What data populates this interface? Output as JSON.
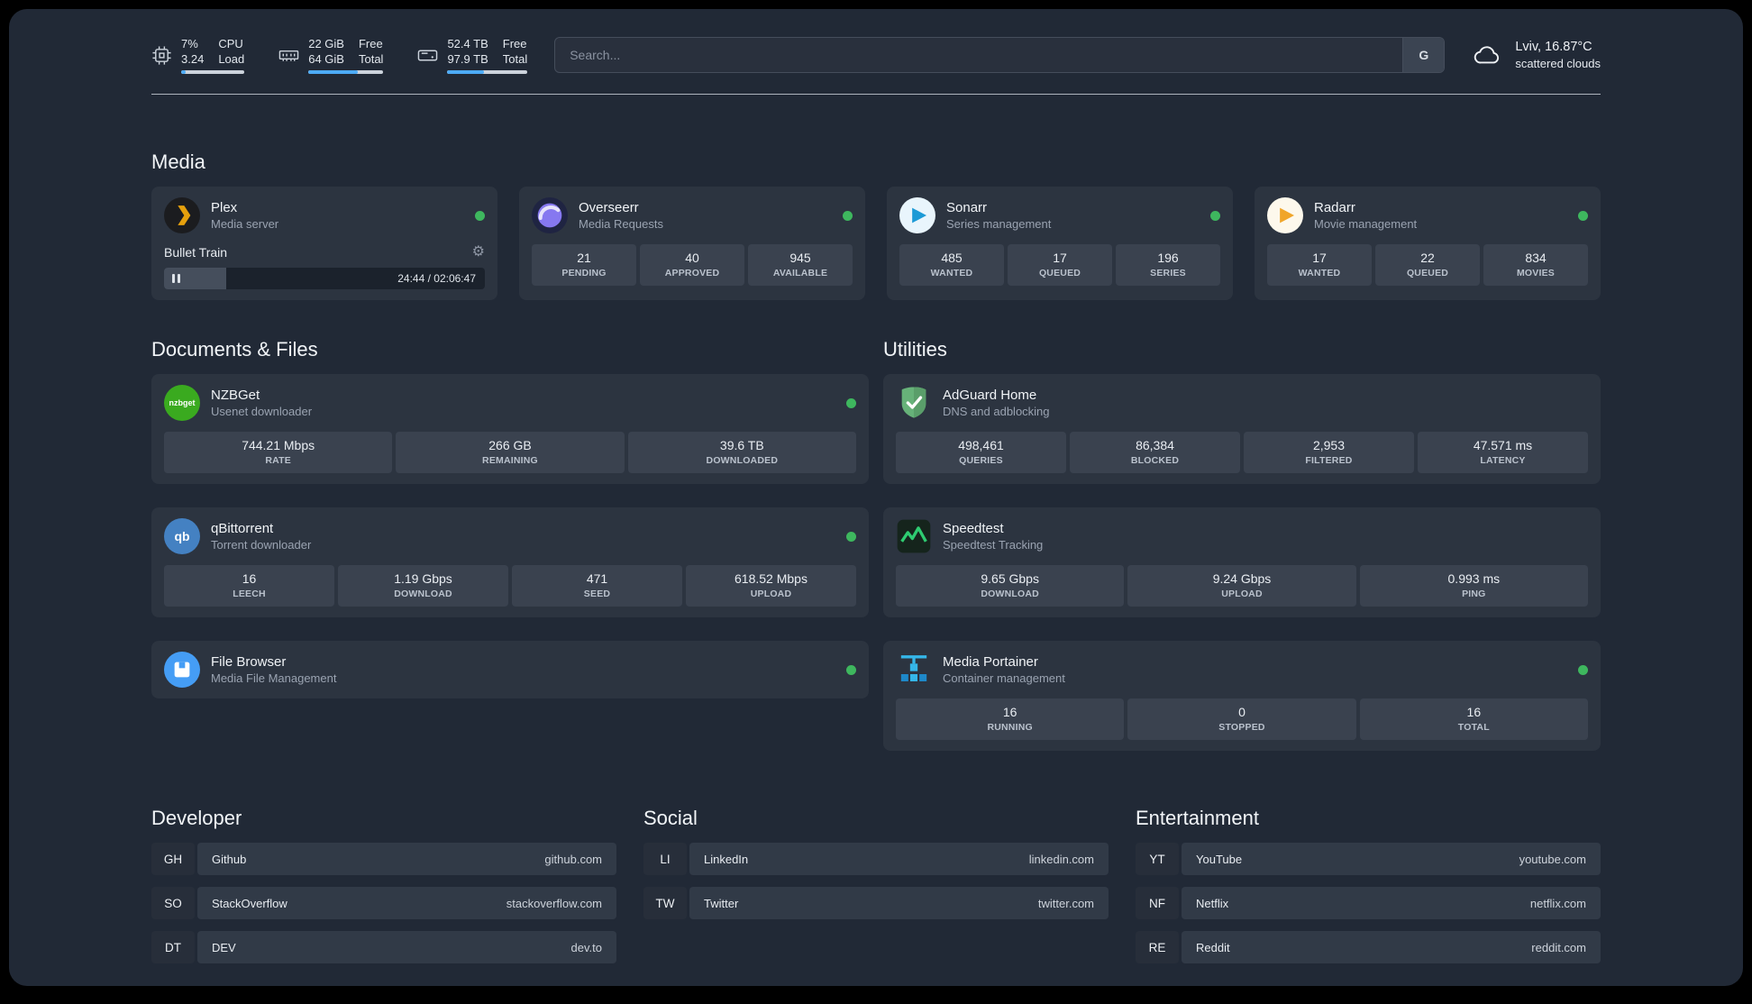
{
  "theme": {
    "bg": "#212936",
    "card": "#2c3440",
    "stat_box": "#3a424f",
    "accent_green": "#3eb75e",
    "bar_fill_blue": "#4dabf7",
    "plex_orange": "#e5a00d"
  },
  "topbar": {
    "cpu": {
      "percent": "7%",
      "load": "3.24",
      "label_top": "CPU",
      "label_bottom": "Load",
      "bar_percent": 7
    },
    "ram": {
      "free": "22 GiB",
      "total": "64 GiB",
      "label_top": "Free",
      "label_bottom": "Total",
      "bar_percent": 66
    },
    "disk": {
      "free": "52.4 TB",
      "total": "97.9 TB",
      "label_top": "Free",
      "label_bottom": "Total",
      "bar_percent": 46
    },
    "search": {
      "placeholder": "Search...",
      "engine_button": "G"
    },
    "weather": {
      "location": "Lviv, 16.87°C",
      "condition": "scattered clouds"
    }
  },
  "sections": {
    "media": "Media",
    "documents": "Documents & Files",
    "utilities": "Utilities",
    "developer": "Developer",
    "social": "Social",
    "entertainment": "Entertainment"
  },
  "apps": {
    "plex": {
      "name": "Plex",
      "desc": "Media server",
      "now_playing": "Bullet Train",
      "time": "24:44 / 02:06:47",
      "progress_percent": 19.5
    },
    "overseerr": {
      "name": "Overseerr",
      "desc": "Media Requests",
      "stats": [
        {
          "value": "21",
          "label": "PENDING"
        },
        {
          "value": "40",
          "label": "APPROVED"
        },
        {
          "value": "945",
          "label": "AVAILABLE"
        }
      ]
    },
    "sonarr": {
      "name": "Sonarr",
      "desc": "Series management",
      "stats": [
        {
          "value": "485",
          "label": "WANTED"
        },
        {
          "value": "17",
          "label": "QUEUED"
        },
        {
          "value": "196",
          "label": "SERIES"
        }
      ]
    },
    "radarr": {
      "name": "Radarr",
      "desc": "Movie management",
      "stats": [
        {
          "value": "17",
          "label": "WANTED"
        },
        {
          "value": "22",
          "label": "QUEUED"
        },
        {
          "value": "834",
          "label": "MOVIES"
        }
      ]
    },
    "nzbget": {
      "name": "NZBGet",
      "desc": "Usenet downloader",
      "icon_text": "nzbget",
      "stats": [
        {
          "value": "744.21 Mbps",
          "label": "RATE"
        },
        {
          "value": "266 GB",
          "label": "REMAINING"
        },
        {
          "value": "39.6 TB",
          "label": "DOWNLOADED"
        }
      ]
    },
    "qbittorrent": {
      "name": "qBittorrent",
      "desc": "Torrent downloader",
      "icon_text": "qb",
      "stats": [
        {
          "value": "16",
          "label": "LEECH"
        },
        {
          "value": "1.19 Gbps",
          "label": "DOWNLOAD"
        },
        {
          "value": "471",
          "label": "SEED"
        },
        {
          "value": "618.52 Mbps",
          "label": "UPLOAD"
        }
      ]
    },
    "filebrowser": {
      "name": "File Browser",
      "desc": "Media File Management"
    },
    "adguard": {
      "name": "AdGuard Home",
      "desc": "DNS and adblocking",
      "stats": [
        {
          "value": "498,461",
          "label": "QUERIES"
        },
        {
          "value": "86,384",
          "label": "BLOCKED"
        },
        {
          "value": "2,953",
          "label": "FILTERED"
        },
        {
          "value": "47.571 ms",
          "label": "LATENCY"
        }
      ]
    },
    "speedtest": {
      "name": "Speedtest",
      "desc": "Speedtest Tracking",
      "stats": [
        {
          "value": "9.65 Gbps",
          "label": "DOWNLOAD"
        },
        {
          "value": "9.24 Gbps",
          "label": "UPLOAD"
        },
        {
          "value": "0.993 ms",
          "label": "PING"
        }
      ]
    },
    "portainer": {
      "name": "Media Portainer",
      "desc": "Container management",
      "stats": [
        {
          "value": "16",
          "label": "RUNNING"
        },
        {
          "value": "0",
          "label": "STOPPED"
        },
        {
          "value": "16",
          "label": "TOTAL"
        }
      ]
    }
  },
  "bookmarks": {
    "developer": {
      "items": [
        {
          "abbr": "GH",
          "name": "Github",
          "url": "github.com"
        },
        {
          "abbr": "SO",
          "name": "StackOverflow",
          "url": "stackoverflow.com"
        },
        {
          "abbr": "DT",
          "name": "DEV",
          "url": "dev.to"
        }
      ]
    },
    "social": {
      "items": [
        {
          "abbr": "LI",
          "name": "LinkedIn",
          "url": "linkedin.com"
        },
        {
          "abbr": "TW",
          "name": "Twitter",
          "url": "twitter.com"
        }
      ]
    },
    "entertainment": {
      "items": [
        {
          "abbr": "YT",
          "name": "YouTube",
          "url": "youtube.com"
        },
        {
          "abbr": "NF",
          "name": "Netflix",
          "url": "netflix.com"
        },
        {
          "abbr": "RE",
          "name": "Reddit",
          "url": "reddit.com"
        }
      ]
    }
  }
}
